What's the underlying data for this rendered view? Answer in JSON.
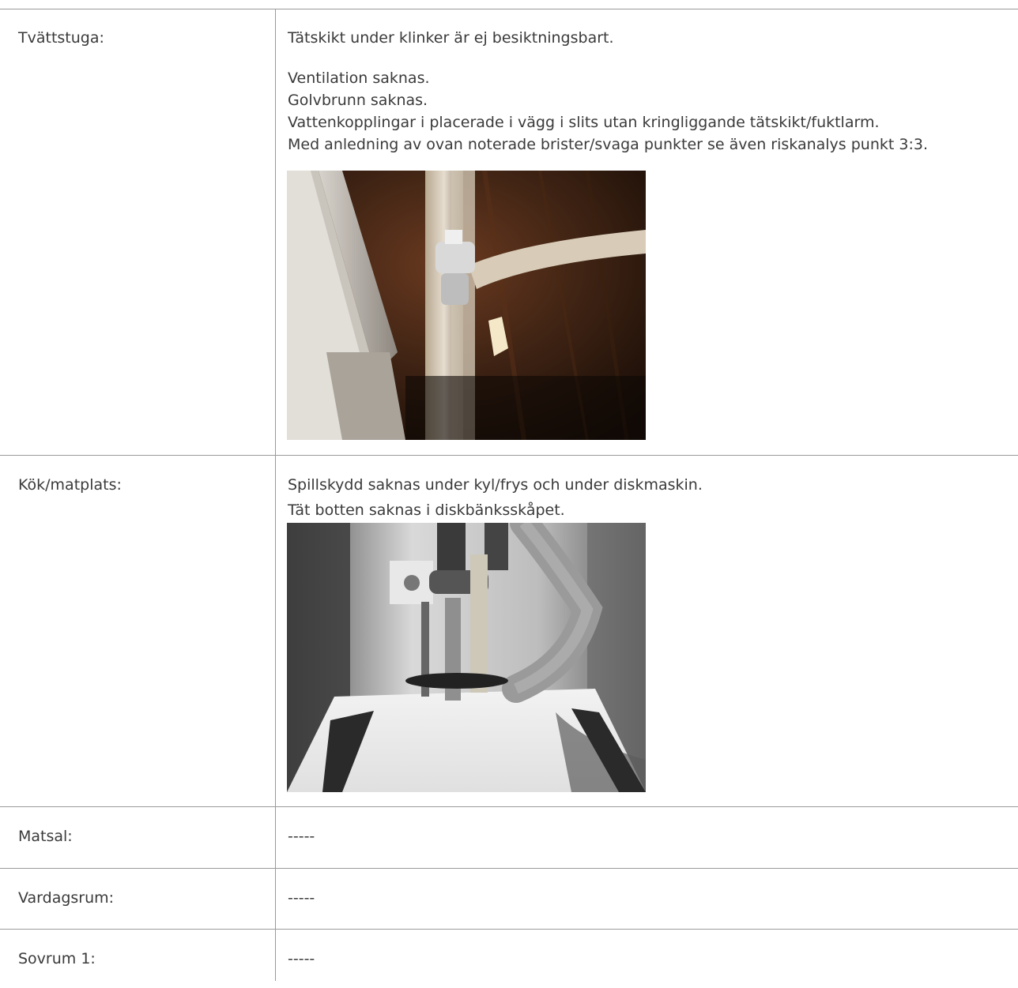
{
  "rows": [
    {
      "label": "Tvättstuga:",
      "paragraph1": "Tätskikt under klinker är ej besiktningsbart.",
      "lines": [
        "Ventilation saknas.",
        "Golvbrunn saknas.",
        "Vattenkopplingar i placerade i vägg i slits utan kringliggande tätskikt/fuktlarm.",
        "Med anledning av ovan noterade brister/svaga punkter se även riskanalys punkt 3:3."
      ]
    },
    {
      "label": "Kök/matplats:",
      "lines": [
        "Spillskydd saknas under kyl/frys och under diskmaskin.",
        "Tät botten saknas i diskbänksskåpet."
      ]
    },
    {
      "label": "Matsal:",
      "value": "-----"
    },
    {
      "label": "Vardagsrum:",
      "value": "-----"
    },
    {
      "label": "Sovrum 1:",
      "value": "-----"
    }
  ]
}
